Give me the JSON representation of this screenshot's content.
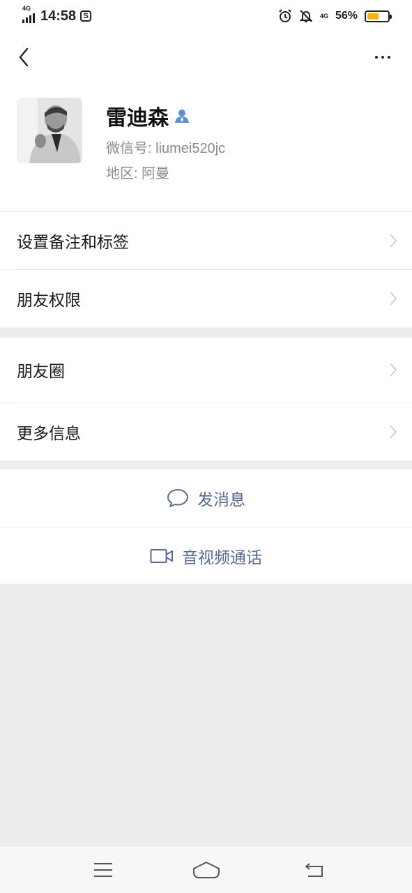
{
  "status_bar": {
    "network": "4G",
    "time": "14:58",
    "app_icon": "S",
    "network_right": "4G",
    "battery_percent": "56%",
    "battery_level": 0.56,
    "icons": [
      "signal-icon",
      "alarm-icon",
      "bell-off-icon",
      "battery-icon"
    ]
  },
  "nav": {
    "back_icon": "back-chevron-icon",
    "more_icon": "more-dots-icon"
  },
  "profile": {
    "name": "雷迪森",
    "wechat_id_label": "微信号: ",
    "wechat_id": "liumei520jc",
    "region_label": "地区: ",
    "region": "阿曼"
  },
  "menu": {
    "remark_tags": "设置备注和标签",
    "friend_permissions": "朋友权限",
    "moments": "朋友圈",
    "more_info": "更多信息"
  },
  "actions": {
    "send_message": "发消息",
    "video_call": "音视频通话"
  },
  "colors": {
    "link_blue": "#576b95",
    "background_gray": "#ededed",
    "battery_fill": "#f5b400"
  }
}
